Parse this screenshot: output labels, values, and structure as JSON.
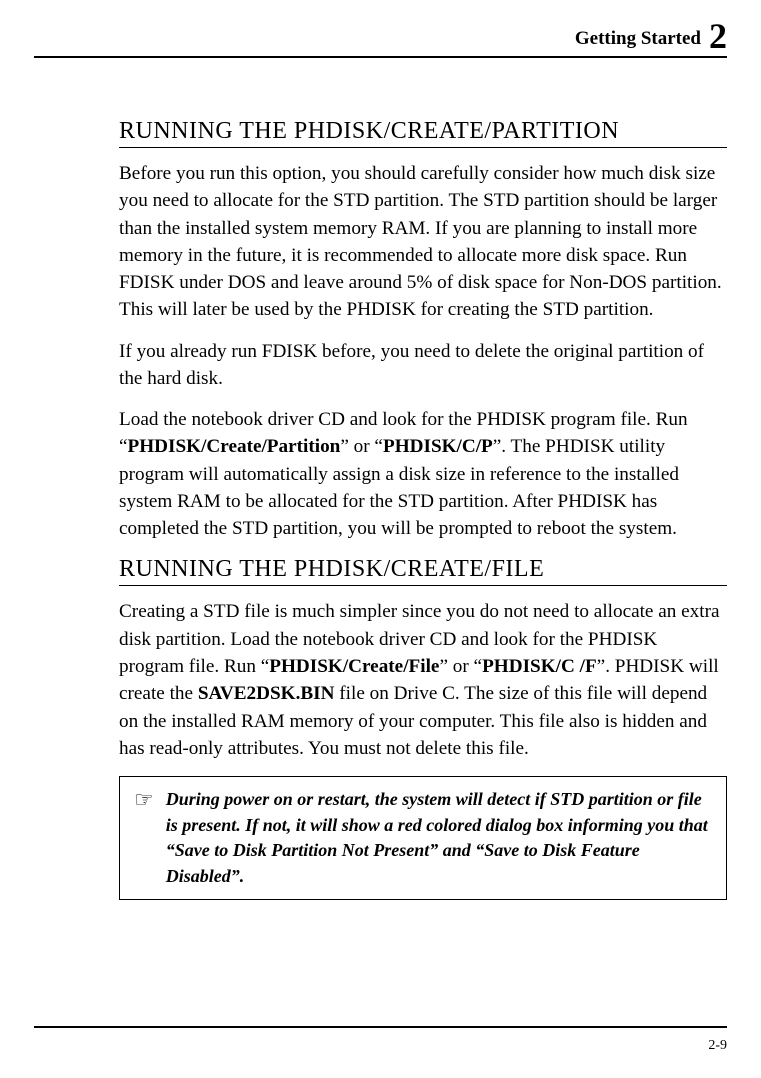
{
  "header": {
    "title": "Getting Started",
    "chapter_num": "2"
  },
  "sections": [
    {
      "heading": "RUNNING THE PHDISK/CREATE/PARTITION",
      "paragraphs": [
        {
          "parts": [
            {
              "t": "Before you run this option, you should carefully consider how much disk size you need to allocate for the STD partition. The STD partition should be larger than the installed system memory RAM. If you are planning to install more memory in the future, it is recommended to allocate more disk space. Run FDISK under DOS and leave around 5% of disk space for Non-DOS partition. This will later be used by the PHDISK for creating the STD partition."
            }
          ]
        },
        {
          "parts": [
            {
              "t": "If you already run FDISK before, you need to delete the original partition of the hard disk."
            }
          ]
        },
        {
          "parts": [
            {
              "t": "Load the notebook driver CD and look for the PHDISK program file. Run “"
            },
            {
              "t": "PHDISK/Create/Partition",
              "b": true
            },
            {
              "t": "” or “"
            },
            {
              "t": "PHDISK/C/P",
              "b": true
            },
            {
              "t": "”. The PHDISK utility program will automatically assign a disk size in reference to the installed system RAM to be allocated for the STD partition. After PHDISK has completed the STD partition, you will be prompted to reboot the system."
            }
          ]
        }
      ]
    },
    {
      "heading": "RUNNING THE PHDISK/CREATE/FILE",
      "paragraphs": [
        {
          "parts": [
            {
              "t": "Creating a STD file is much simpler since you do not need to allocate an extra disk partition. Load the notebook driver CD and look for the PHDISK program file. Run “"
            },
            {
              "t": "PHDISK/Create/File",
              "b": true
            },
            {
              "t": "” or “"
            },
            {
              "t": "PHDISK/C /F",
              "b": true
            },
            {
              "t": "”. PHDISK will create the "
            },
            {
              "t": "SAVE2DSK.BIN",
              "b": true
            },
            {
              "t": " file on Drive C. The size of this file will depend on the installed RAM memory of your computer. This file also is hidden and has read-only attributes. You must not delete this file."
            }
          ]
        }
      ]
    }
  ],
  "note": {
    "icon": "☞",
    "text": "During power on or restart, the system will detect if STD partition or file is present. If not, it will show a red colored dialog box informing you that “Save to Disk Partition Not Present” and “Save to Disk Feature Disabled”."
  },
  "footer": {
    "page_num": "2-9"
  }
}
